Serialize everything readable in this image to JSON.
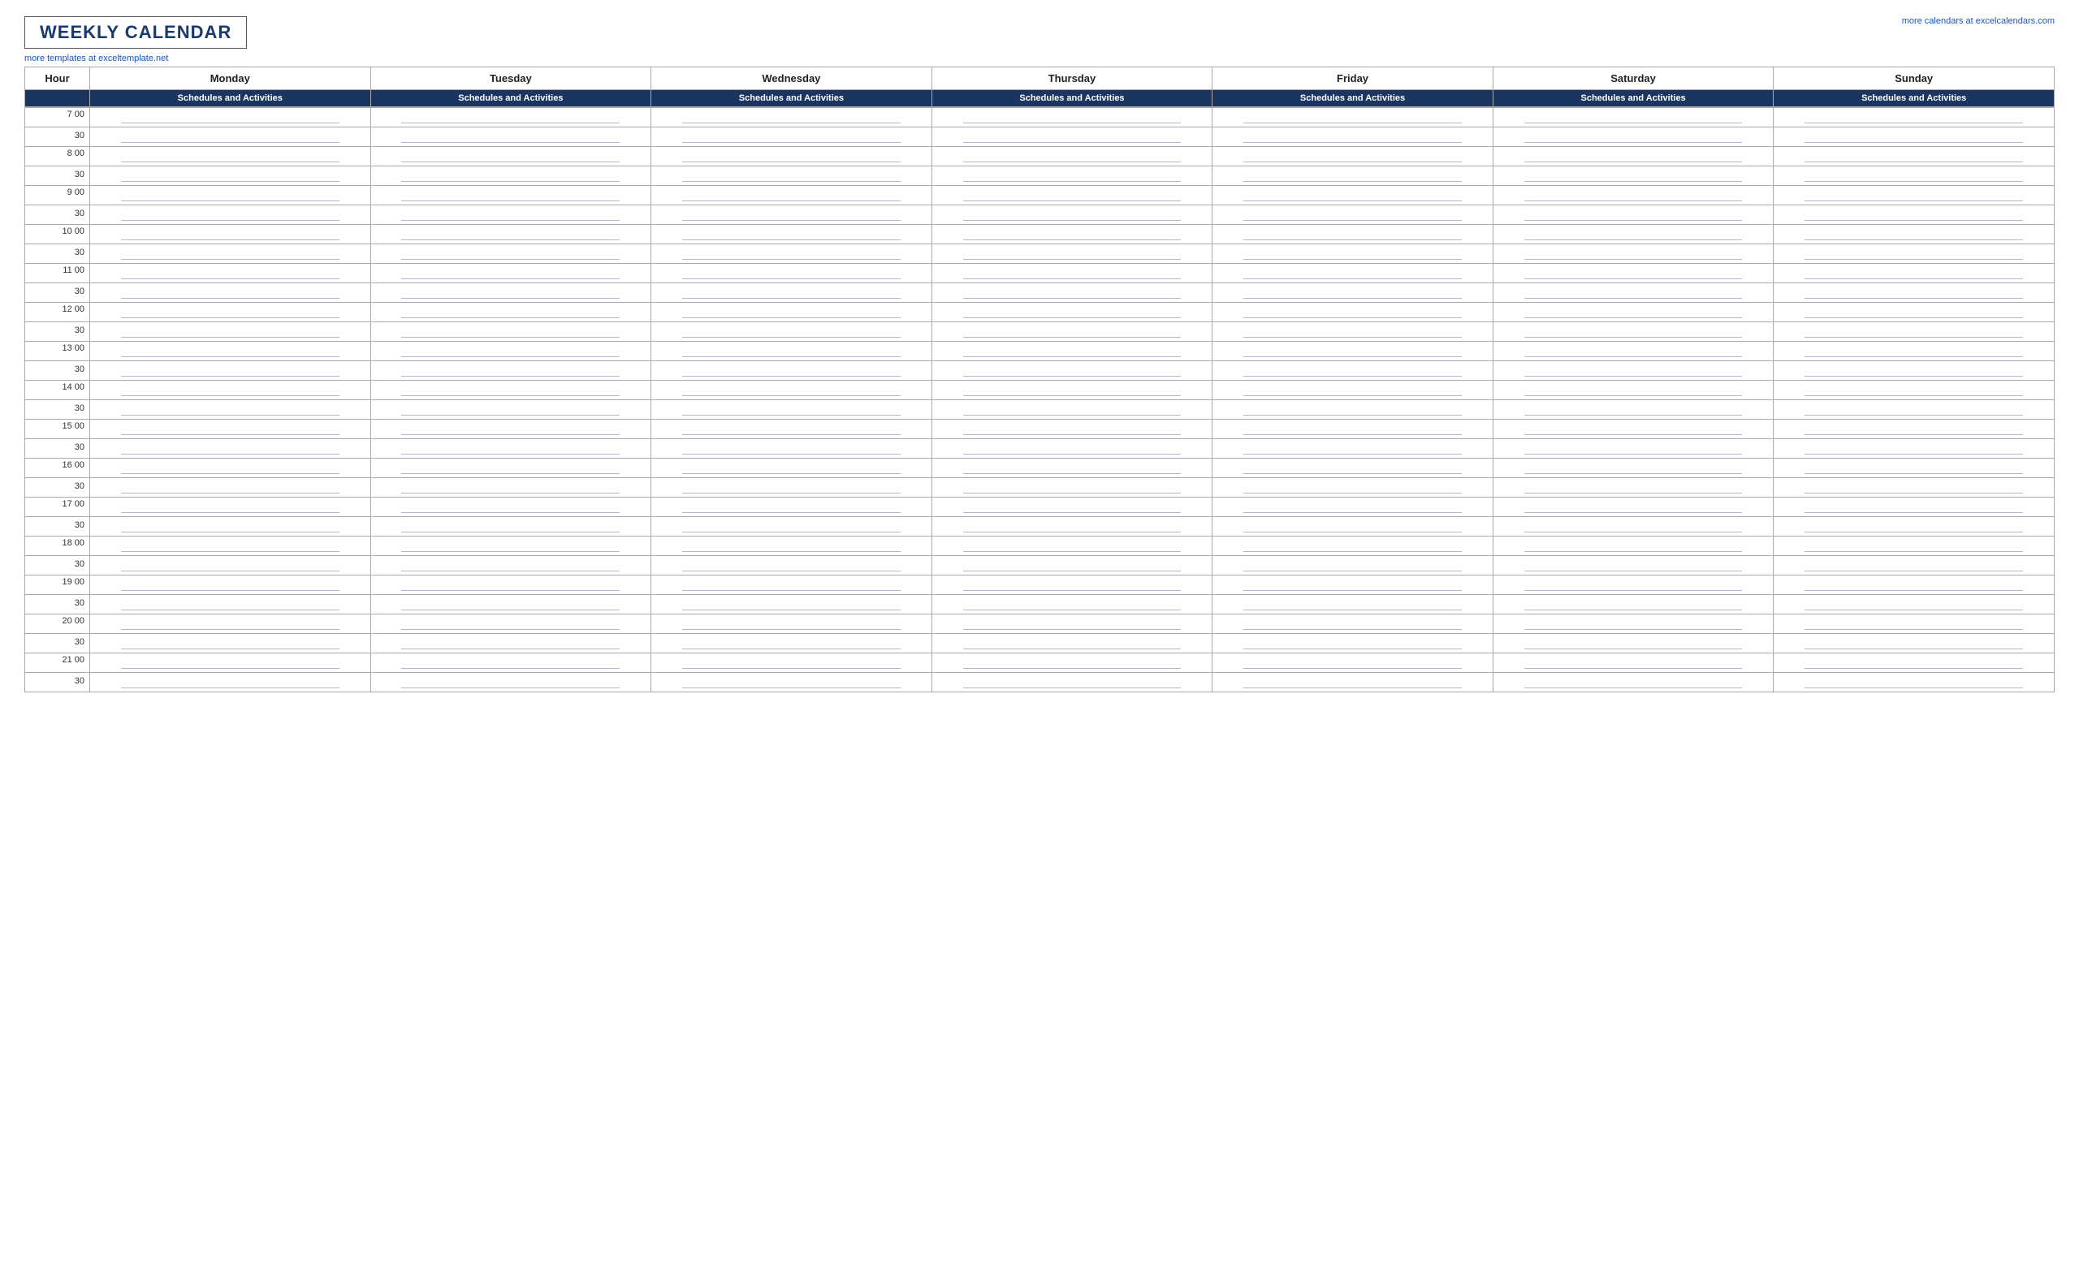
{
  "header": {
    "title": "WEEKLY CALENDAR",
    "link_left": "more templates at exceltemplate.net",
    "link_right": "more calendars at excelcalendars.com"
  },
  "table": {
    "hour_label": "Hour",
    "days": [
      "Monday",
      "Tuesday",
      "Wednesday",
      "Thursday",
      "Friday",
      "Saturday",
      "Sunday"
    ],
    "subheader": "Schedules and Activities",
    "time_slots": [
      {
        "hour": "7",
        "label_hour": "7  00",
        "label_half": "30"
      },
      {
        "hour": "8",
        "label_hour": "8  00",
        "label_half": "30"
      },
      {
        "hour": "9",
        "label_hour": "9  00",
        "label_half": "30"
      },
      {
        "hour": "10",
        "label_hour": "10  00",
        "label_half": "30"
      },
      {
        "hour": "11",
        "label_hour": "11  00",
        "label_half": "30"
      },
      {
        "hour": "12",
        "label_hour": "12  00",
        "label_half": "30"
      },
      {
        "hour": "13",
        "label_hour": "13  00",
        "label_half": "30"
      },
      {
        "hour": "14",
        "label_hour": "14  00",
        "label_half": "30"
      },
      {
        "hour": "15",
        "label_hour": "15  00",
        "label_half": "30"
      },
      {
        "hour": "16",
        "label_hour": "16  00",
        "label_half": "30"
      },
      {
        "hour": "17",
        "label_hour": "17  00",
        "label_half": "30"
      },
      {
        "hour": "18",
        "label_hour": "18  00",
        "label_half": "30"
      },
      {
        "hour": "19",
        "label_hour": "19  00",
        "label_half": "30"
      },
      {
        "hour": "20",
        "label_hour": "20  00",
        "label_half": "30"
      },
      {
        "hour": "21",
        "label_hour": "21  00",
        "label_half": "30"
      }
    ]
  }
}
